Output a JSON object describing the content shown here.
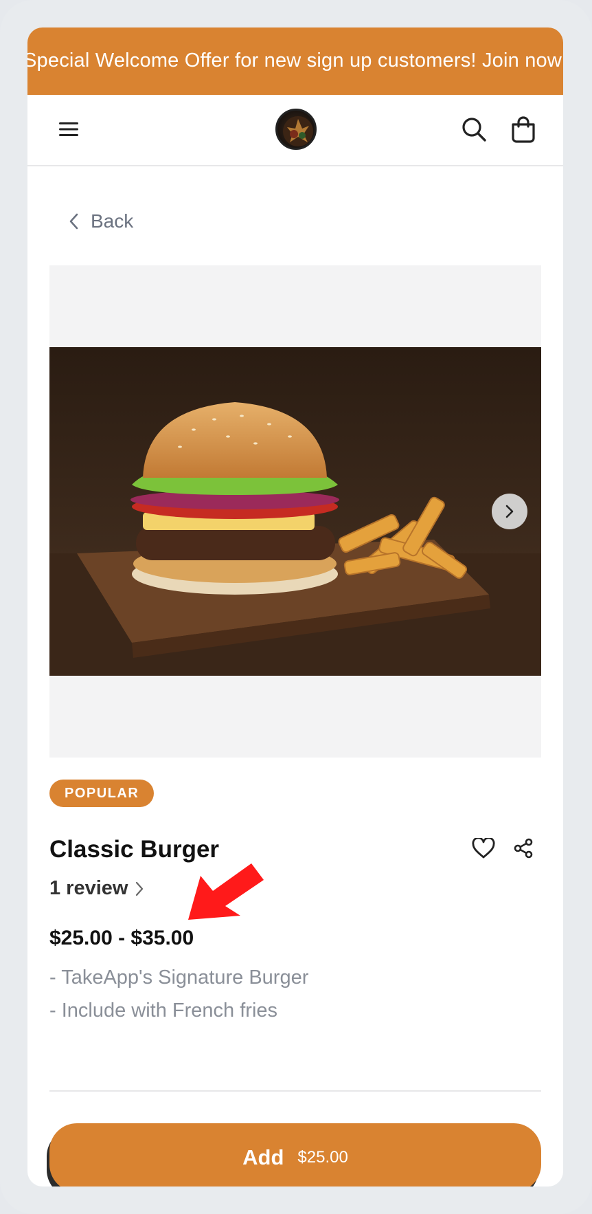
{
  "banner": {
    "text": "Special Welcome Offer for new sign up customers! Join now"
  },
  "header": {
    "menu_icon": "hamburger-menu-icon",
    "logo": "store-logo",
    "search_icon": "search-icon",
    "cart_icon": "shopping-bag-icon"
  },
  "nav": {
    "back_label": "Back"
  },
  "product": {
    "badge": "POPULAR",
    "title": "Classic Burger",
    "reviews_label": "1 review",
    "price_range": "$25.00 - $35.00",
    "description": [
      "- TakeApp's Signature Burger",
      "- Include with French fries"
    ],
    "favorite_icon": "heart-icon",
    "share_icon": "share-icon"
  },
  "cta": {
    "label": "Add",
    "price": "$25.00"
  },
  "colors": {
    "accent": "#d98331",
    "annotation_arrow": "#ff1a1a"
  }
}
